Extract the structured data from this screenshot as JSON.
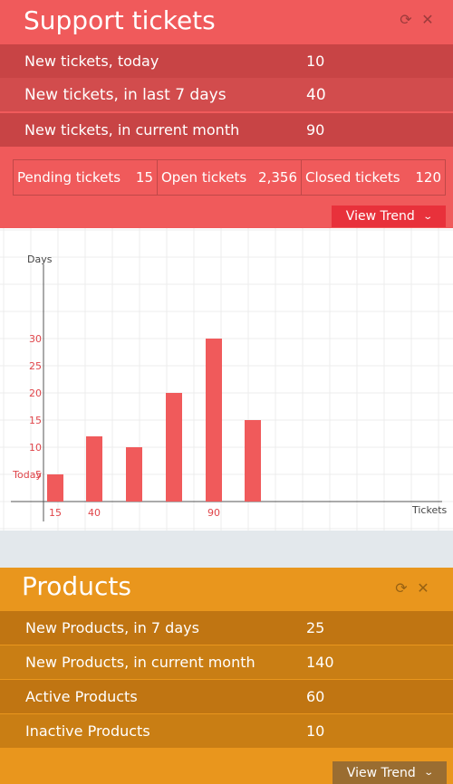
{
  "support": {
    "title": "Support tickets",
    "refresh_icon": "refresh-icon",
    "close_icon": "close-icon",
    "stats": [
      {
        "label": "New tickets, today",
        "value": "10"
      },
      {
        "label": "New tickets, in last 7 days",
        "value": "40"
      },
      {
        "label": "New tickets, in current month",
        "value": "90"
      }
    ],
    "pending": {
      "label": "Pending tickets",
      "value": "15"
    },
    "open": {
      "label": "Open tickets",
      "value": "2,356"
    },
    "closed": {
      "label": "Closed tickets",
      "value": "120"
    },
    "trend_label": "View Trend",
    "colors": {
      "panel": "#f05a5b",
      "row_dark": "#c84445",
      "row_mid": "#d24c4d",
      "button": "#e8313b"
    }
  },
  "chart_data": {
    "type": "bar",
    "ylabel": "Days",
    "xlabel": "Tickets",
    "ylim": [
      0,
      35
    ],
    "yticks": [
      5,
      10,
      15,
      20,
      25,
      30
    ],
    "y_marker_label": "Today",
    "x_tick_labels": [
      "15",
      "40",
      "",
      "",
      "90",
      ""
    ],
    "values": [
      5,
      12,
      10,
      20,
      30,
      15
    ],
    "grid": true,
    "bar_color": "#f05a5b"
  },
  "products": {
    "title": "Products",
    "refresh_icon": "refresh-icon",
    "close_icon": "close-icon",
    "stats": [
      {
        "label": "New Products, in 7 days",
        "value": "25"
      },
      {
        "label": "New Products, in current month",
        "value": "140"
      },
      {
        "label": "Active Products",
        "value": "60"
      },
      {
        "label": "Inactive Products",
        "value": "10"
      }
    ],
    "trend_label": "View Trend",
    "colors": {
      "panel": "#e9961d",
      "row_dark": "#c07512",
      "row_mid": "#c97e14",
      "button": "#9a6d31"
    }
  }
}
